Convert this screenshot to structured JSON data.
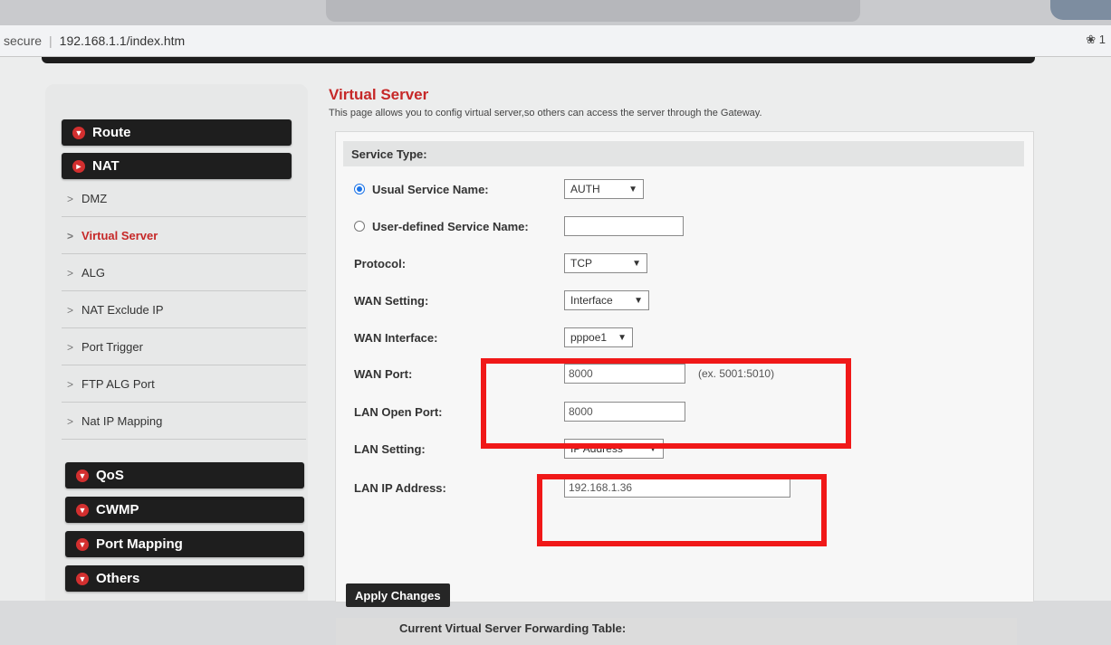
{
  "browser": {
    "secure_label": "secure",
    "url": "192.168.1.1/index.htm",
    "right_icons": "❀ 1"
  },
  "sidebar": {
    "route": "Route",
    "nat": "NAT",
    "nat_items": [
      "DMZ",
      "Virtual Server",
      "ALG",
      "NAT Exclude IP",
      "Port Trigger",
      "FTP ALG Port",
      "Nat IP Mapping"
    ],
    "bottom_menus": [
      "QoS",
      "CWMP",
      "Port Mapping",
      "Others"
    ]
  },
  "main": {
    "title": "Virtual Server",
    "description": "This page allows you to config virtual server,so others can access the server through the Gateway.",
    "service_type_label": "Service Type:",
    "usual_service_label": "Usual Service Name:",
    "usual_service_value": "AUTH",
    "user_defined_label": "User-defined Service Name:",
    "user_defined_value": "",
    "protocol_label": "Protocol:",
    "protocol_value": "TCP",
    "wan_setting_label": "WAN Setting:",
    "wan_setting_value": "Interface",
    "wan_interface_label": "WAN Interface:",
    "wan_interface_value": "pppoe1",
    "wan_port_label": "WAN Port:",
    "wan_port_value": "8000",
    "wan_port_hint": "(ex. 5001:5010)",
    "lan_open_port_label": "LAN Open Port:",
    "lan_open_port_value": "8000",
    "lan_setting_label": "LAN Setting:",
    "lan_setting_value": "IP Address",
    "lan_ip_label": "LAN IP Address:",
    "lan_ip_value": "192.168.1.36",
    "apply_label": "Apply Changes",
    "table_heading": "Current Virtual Server Forwarding Table:"
  },
  "colors": {
    "accent_red": "#c62828",
    "highlight_red": "#f01818",
    "menu_dark": "#1e1e1e"
  }
}
